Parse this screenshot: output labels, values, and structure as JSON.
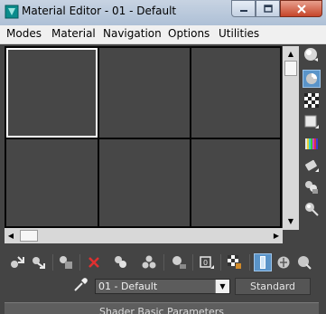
{
  "window": {
    "title": "Material Editor - 01 - Default"
  },
  "menubar": {
    "items": [
      "Modes",
      "Material",
      "Navigation",
      "Options",
      "Utilities"
    ]
  },
  "sample_slots": {
    "count": 6,
    "active_index": 0,
    "background_color": "#474747"
  },
  "side_toolbar": {
    "icons": [
      "sample-type-sphere-icon",
      "backlight-icon",
      "background-checker-icon",
      "sample-uv-tiling-icon",
      "video-color-check-icon",
      "make-preview-icon",
      "material-id-options-icon",
      "select-by-material-icon"
    ],
    "active": "backlight-icon"
  },
  "bottom_toolbar": {
    "icons": [
      "get-material-icon",
      "put-to-scene-icon",
      "assign-to-selection-icon",
      "reset-map-icon",
      "copy-material-icon",
      "make-unique-icon",
      "put-to-library-icon",
      "material-id-channel-icon",
      "show-shaded-icon",
      "show-end-result-icon",
      "go-to-parent-icon",
      "go-forward-sibling-icon",
      "options-icon"
    ],
    "active": "show-end-result-icon"
  },
  "material": {
    "name": "01 - Default",
    "type": "Standard"
  },
  "rollout": {
    "label": "Shader Basic Parameters"
  },
  "colors": {
    "accent": "#5a94c9",
    "panel": "#444444",
    "close_button": "#c6452a"
  }
}
